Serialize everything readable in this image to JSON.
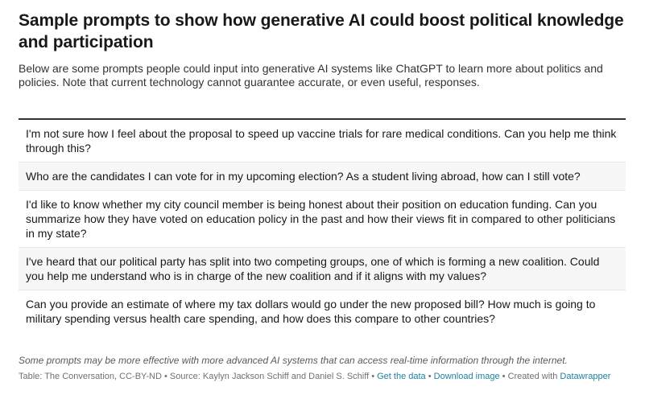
{
  "title": "Sample prompts to show how generative AI could boost political knowledge and participation",
  "description": "Below are some prompts people could input into generative AI systems like ChatGPT to learn more about politics and policies. Note that current technology cannot guarantee accurate, or even useful, responses.",
  "rows": [
    "I'm not sure how I feel about the proposal to speed up vaccine trials for rare medical conditions. Can you help me think through this?",
    "Who are the candidates I can vote for in my upcoming election? As a student living abroad, how can I still vote?",
    "I'd like to know whether my city council member is being honest about their position on education funding. Can you summarize how they have voted on education policy in the past and how their views fit in compared to other politicians in my state?",
    "I've heard that our political party has split into two competing groups, one of which is forming a new coalition. Could you help me understand who is in charge of the new coalition and if it aligns with my values?",
    "Can you provide an estimate of where my tax dollars would go under the new proposed bill? How much is going to military spending versus health care spending, and how does this compare to other countries?"
  ],
  "notes": "Some prompts may be more effective with more advanced AI systems that can access real-time information through the internet.",
  "footer": {
    "table_credit": "Table: The Conversation, CC-BY-ND",
    "source": "Source: Kaylyn Jackson Schiff and Daniel S. Schiff",
    "get_data": "Get the data",
    "download_image": "Download image",
    "created_with": "Created with",
    "datawrapper": "Datawrapper",
    "separator": "•"
  },
  "colors": {
    "link": "#1d81a2",
    "row_alt_bg": "#f7f7f7",
    "rule": "#333333"
  }
}
